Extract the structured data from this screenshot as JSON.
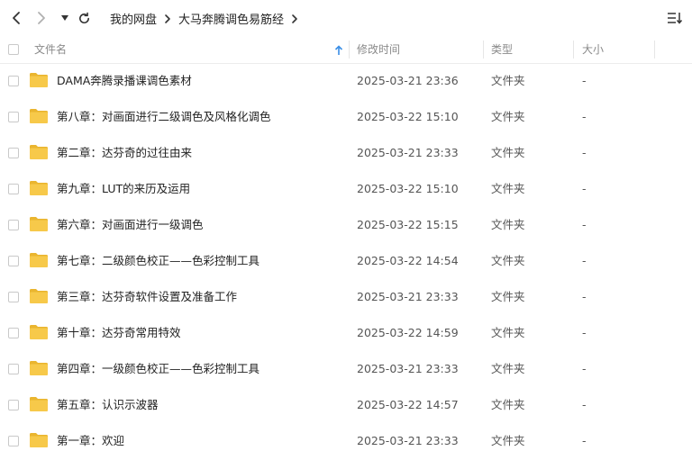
{
  "toolbar": {
    "back_icon": "chevron-left-icon",
    "forward_icon": "chevron-right-icon",
    "history_icon": "caret-down-icon",
    "refresh_icon": "refresh-icon",
    "view_icon": "sort-list-icon"
  },
  "breadcrumb": {
    "items": [
      "我的网盘",
      "大马奔腾调色易筋经"
    ]
  },
  "table": {
    "columns": {
      "name": "文件名",
      "modified": "修改时间",
      "type": "类型",
      "size": "大小"
    },
    "sort_icon": "sort-ascending-icon",
    "rows": [
      {
        "name": "DAMA奔腾录播课调色素材",
        "modified": "2025-03-21 23:36",
        "type": "文件夹",
        "size": "-"
      },
      {
        "name": "第八章：对画面进行二级调色及风格化调色",
        "modified": "2025-03-22 15:10",
        "type": "文件夹",
        "size": "-"
      },
      {
        "name": "第二章：达芬奇的过往由来",
        "modified": "2025-03-21 23:33",
        "type": "文件夹",
        "size": "-"
      },
      {
        "name": "第九章：LUT的来历及运用",
        "modified": "2025-03-22 15:10",
        "type": "文件夹",
        "size": "-"
      },
      {
        "name": "第六章：对画面进行一级调色",
        "modified": "2025-03-22 15:15",
        "type": "文件夹",
        "size": "-"
      },
      {
        "name": "第七章：二级颜色校正——色彩控制工具",
        "modified": "2025-03-22 14:54",
        "type": "文件夹",
        "size": "-"
      },
      {
        "name": "第三章：达芬奇软件设置及准备工作",
        "modified": "2025-03-21 23:33",
        "type": "文件夹",
        "size": "-"
      },
      {
        "name": "第十章：达芬奇常用特效",
        "modified": "2025-03-22 14:59",
        "type": "文件夹",
        "size": "-"
      },
      {
        "name": "第四章：一级颜色校正——色彩控制工具",
        "modified": "2025-03-21 23:33",
        "type": "文件夹",
        "size": "-"
      },
      {
        "name": "第五章：认识示波器",
        "modified": "2025-03-22 14:57",
        "type": "文件夹",
        "size": "-"
      },
      {
        "name": "第一章：欢迎",
        "modified": "2025-03-21 23:33",
        "type": "文件夹",
        "size": "-"
      }
    ]
  },
  "colors": {
    "folder": "#f7c94a",
    "folder_dark": "#eab52f",
    "sort_accent": "#3a8ee6"
  }
}
